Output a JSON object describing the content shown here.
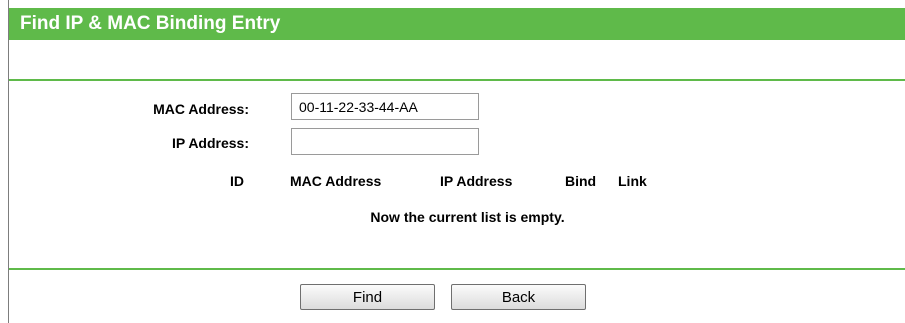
{
  "title": "Find IP & MAC Binding Entry",
  "form": {
    "mac_label": "MAC Address:",
    "mac_value": "00-11-22-33-44-AA",
    "ip_label": "IP Address:",
    "ip_value": ""
  },
  "table": {
    "columns": [
      "ID",
      "MAC Address",
      "IP Address",
      "Bind",
      "Link"
    ],
    "empty_message": "Now the current list is empty."
  },
  "buttons": {
    "find": "Find",
    "back": "Back"
  },
  "colors": {
    "accent": "#5fba4a"
  }
}
